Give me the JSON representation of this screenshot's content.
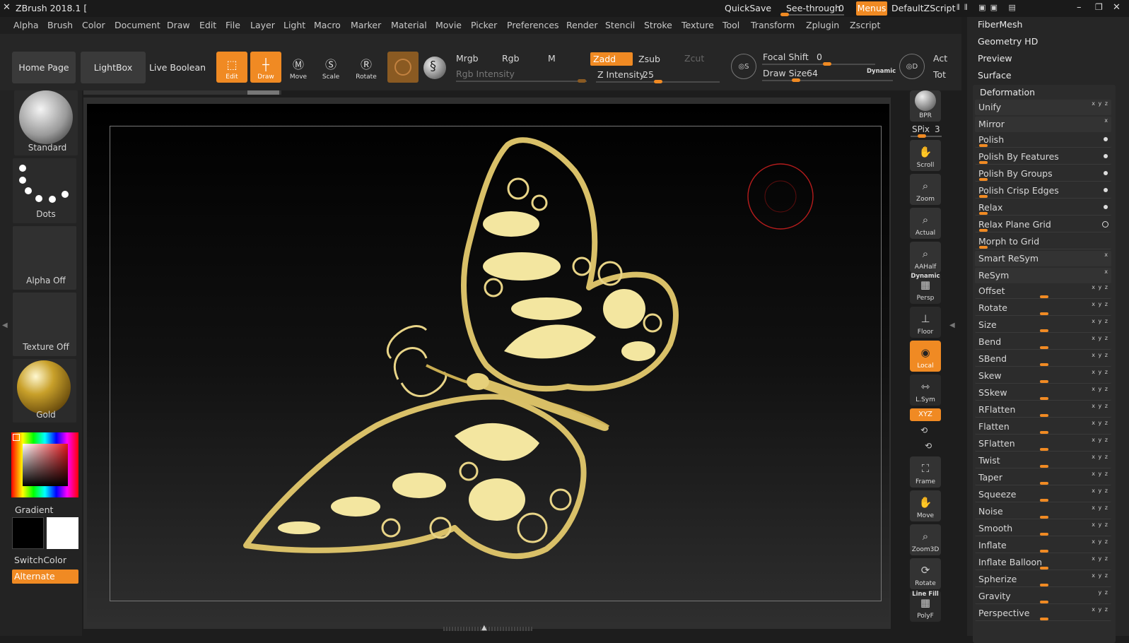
{
  "titlebar": {
    "app_title": "ZBrush 2018.1 [",
    "quicksave": "QuickSave",
    "see_through_label": "See-through",
    "see_through_value": "0",
    "menus": "Menus",
    "script": "DefaultZScript",
    "icons": [
      "zbrush-logo-icon",
      "layout-icons",
      "minimize-icon",
      "maximize-icon",
      "close-icon"
    ]
  },
  "menubar": {
    "items": [
      "Alpha",
      "Brush",
      "Color",
      "Document",
      "Draw",
      "Edit",
      "File",
      "Layer",
      "Light",
      "Macro",
      "Marker",
      "Material",
      "Movie",
      "Picker",
      "Preferences",
      "Render",
      "Stencil",
      "Stroke",
      "Texture",
      "Tool",
      "Transform",
      "Zplugin",
      "Zscript"
    ]
  },
  "shelf": {
    "home_page": "Home Page",
    "lightbox": "LightBox",
    "live_boolean": "Live Boolean",
    "tools": [
      {
        "label": "Edit",
        "active": true,
        "icon": "edit-icon"
      },
      {
        "label": "Draw",
        "active": true,
        "icon": "draw-icon"
      },
      {
        "label": "Move",
        "active": false,
        "icon": "move-icon"
      },
      {
        "label": "Scale",
        "active": false,
        "icon": "scale-icon"
      },
      {
        "label": "Rotate",
        "active": false,
        "icon": "rotate-icon"
      }
    ],
    "mrgb": "Mrgb",
    "rgb": "Rgb",
    "m": "M",
    "rgb_intensity": "Rgb Intensity",
    "zadd": "Zadd",
    "zsub": "Zsub",
    "zcut": "Zcut",
    "z_intensity_label": "Z Intensity",
    "z_intensity_value": "25",
    "focal_shift_label": "Focal Shift",
    "focal_shift_value": "0",
    "draw_size_label": "Draw Size",
    "draw_size_value": "64",
    "dynamic": "Dynamic",
    "act": "Act",
    "tot": "Tot"
  },
  "left": {
    "brush": "Standard",
    "stroke": "Dots",
    "alpha": "Alpha Off",
    "texture": "Texture Off",
    "material": "Gold",
    "gradient": "Gradient",
    "switch_color": "SwitchColor",
    "alternate": "Alternate"
  },
  "vtoolbar": {
    "bpr": "BPR",
    "spix_label": "SPix",
    "spix_value": "3",
    "items": [
      {
        "label": "Scroll",
        "icon": "scroll-hand-icon"
      },
      {
        "label": "Zoom",
        "icon": "zoom-icon"
      },
      {
        "label": "Actual",
        "icon": "actual-icon"
      },
      {
        "label": "AAHalf",
        "icon": "aahalf-icon"
      },
      {
        "label": "Persp",
        "icon": "persp-icon",
        "top": "Dynamic"
      },
      {
        "label": "Floor",
        "icon": "floor-icon"
      },
      {
        "label": "Local",
        "icon": "local-icon",
        "active": true
      },
      {
        "label": "L.Sym",
        "icon": "lsym-icon"
      }
    ],
    "xyz": "XYZ",
    "lower": [
      {
        "label": "Frame",
        "icon": "frame-icon"
      },
      {
        "label": "Move",
        "icon": "move-hand-icon"
      },
      {
        "label": "Zoom3D",
        "icon": "zoom3d-icon"
      },
      {
        "label": "Rotate",
        "icon": "rotate3d-icon"
      },
      {
        "label": "PolyF",
        "icon": "polyf-icon",
        "top": "Line Fill"
      }
    ]
  },
  "right": {
    "headers": [
      "FiberMesh",
      "Geometry HD",
      "Preview",
      "Surface"
    ],
    "deformation": "Deformation",
    "rows": [
      {
        "label": "Unify",
        "type": "btn",
        "ax": "x y z"
      },
      {
        "label": "Mirror",
        "type": "btn",
        "ax": "x"
      },
      {
        "label": "Polish",
        "type": "sl0",
        "end": "dot"
      },
      {
        "label": "Polish By Features",
        "type": "sl0",
        "end": "dot"
      },
      {
        "label": "Polish By Groups",
        "type": "sl0",
        "end": "dot"
      },
      {
        "label": "Polish Crisp Edges",
        "type": "sl0",
        "end": "dot"
      },
      {
        "label": "Relax",
        "type": "sl0",
        "end": "dot"
      },
      {
        "label": "Relax Plane Grid",
        "type": "sl0",
        "end": "ring"
      },
      {
        "label": "Morph to Grid",
        "type": "sl0",
        "end": ""
      },
      {
        "label": "Smart ReSym",
        "type": "btn",
        "ax": "x"
      },
      {
        "label": "ReSym",
        "type": "btn",
        "ax": "x"
      },
      {
        "label": "Offset",
        "type": "slc",
        "ax": "x y z"
      },
      {
        "label": "Rotate",
        "type": "slc",
        "ax": "x y z"
      },
      {
        "label": "Size",
        "type": "slc",
        "ax": "x y z"
      },
      {
        "label": "Bend",
        "type": "slc",
        "ax": "x y z"
      },
      {
        "label": "SBend",
        "type": "slc",
        "ax": "x y z"
      },
      {
        "label": "Skew",
        "type": "slc",
        "ax": "x y z"
      },
      {
        "label": "SSkew",
        "type": "slc",
        "ax": "x y z"
      },
      {
        "label": "RFlatten",
        "type": "slc",
        "ax": "x y z"
      },
      {
        "label": "Flatten",
        "type": "slc",
        "ax": "x y z"
      },
      {
        "label": "SFlatten",
        "type": "slc",
        "ax": "x y z"
      },
      {
        "label": "Twist",
        "type": "slc",
        "ax": "x y z"
      },
      {
        "label": "Taper",
        "type": "slc",
        "ax": "x y z"
      },
      {
        "label": "Squeeze",
        "type": "slc",
        "ax": "x y z"
      },
      {
        "label": "Noise",
        "type": "slc",
        "ax": "x y z"
      },
      {
        "label": "Smooth",
        "type": "slc",
        "ax": "x y z"
      },
      {
        "label": "Inflate",
        "type": "slc",
        "ax": "x y z"
      },
      {
        "label": "Inflate Balloon",
        "type": "slc",
        "ax": "x y z"
      },
      {
        "label": "Spherize",
        "type": "slc",
        "ax": "x y z"
      },
      {
        "label": "Gravity",
        "type": "slc",
        "ax": "y z"
      },
      {
        "label": "Perspective",
        "type": "slc",
        "ax": "x y z"
      }
    ]
  },
  "colors": {
    "accent": "#f08a23",
    "gold": "#f3e6a0",
    "brush_ring": "#c0201e"
  }
}
